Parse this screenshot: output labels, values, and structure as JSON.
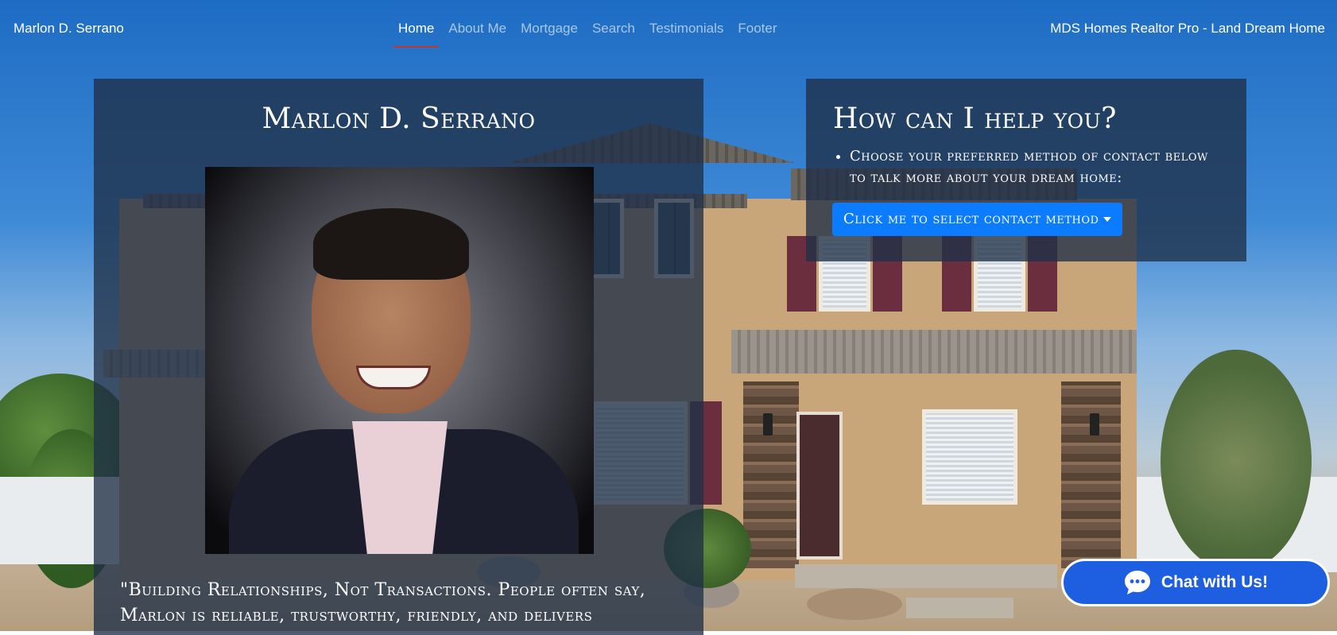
{
  "nav": {
    "brand": "Marlon D. Serrano",
    "links": [
      {
        "label": "Home",
        "active": true
      },
      {
        "label": "About Me",
        "active": false
      },
      {
        "label": "Mortgage",
        "active": false
      },
      {
        "label": "Search",
        "active": false
      },
      {
        "label": "Testimonials",
        "active": false
      },
      {
        "label": "Footer",
        "active": false
      }
    ],
    "tagline": "MDS Homes Realtor Pro - Land Dream Home"
  },
  "hero": {
    "name": "Marlon D. Serrano",
    "quote": "\"Building Relationships, Not Transactions. People often say, Marlon is reliable, trustworthy, friendly, and delivers"
  },
  "contact": {
    "title": "How can I help you?",
    "instruction": "Choose your preferred method of contact below to talk more about your dream home:",
    "button_label": "Click me to select contact method"
  },
  "chat": {
    "label": "Chat with Us!",
    "icon": "chat-bubble-icon"
  },
  "colors": {
    "primary_button": "#0b7bff",
    "chat_button": "#1d5fe0",
    "active_underline": "#c0392b",
    "panel_overlay": "rgba(31,47,70,0.78)"
  }
}
